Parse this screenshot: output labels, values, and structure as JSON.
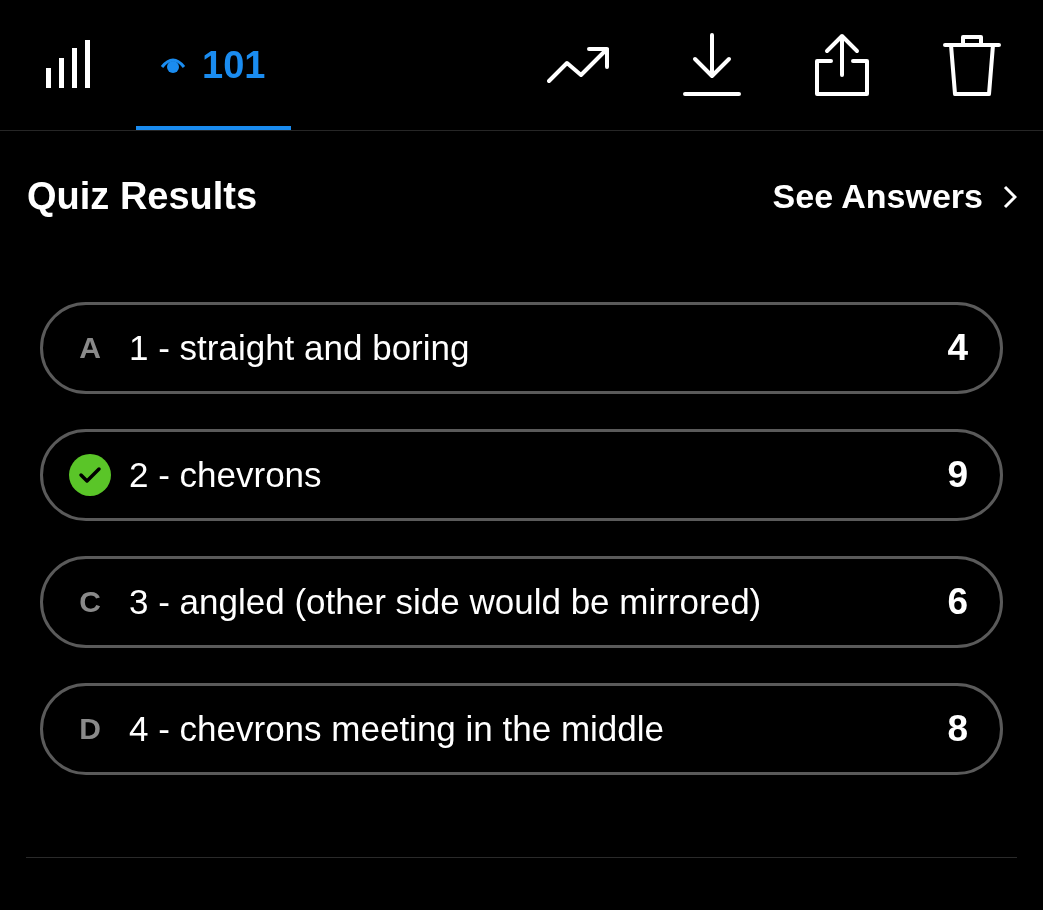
{
  "tabs": [
    {
      "kind": "stats",
      "selected": false
    },
    {
      "kind": "views",
      "label": "101",
      "selected": true
    }
  ],
  "actions": [
    {
      "kind": "trend"
    },
    {
      "kind": "download"
    },
    {
      "kind": "share"
    },
    {
      "kind": "delete"
    }
  ],
  "title": "Quiz Results",
  "see_answers": "See Answers",
  "options": [
    {
      "letter": "A",
      "text": "1 - straight and boring",
      "count": "4",
      "correct": false
    },
    {
      "text": "2 - chevrons",
      "count": "9",
      "correct": true
    },
    {
      "letter": "C",
      "text": "3 - angled (other side would be mirrored)",
      "count": "6",
      "correct": false
    },
    {
      "letter": "D",
      "text": "4 - chevrons meeting in the middle",
      "count": "8",
      "correct": false
    }
  ]
}
